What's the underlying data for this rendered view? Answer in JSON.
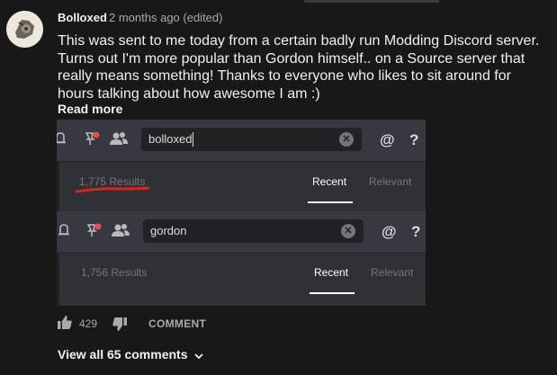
{
  "comment": {
    "author": "Bolloxed",
    "time": "2 months ago (edited)",
    "text": "This was sent to me today from a certain badly run Modding Discord server. Turns out I'm more popular than Gordon himself.. on a Source server that really means something!  Thanks to everyone who likes to sit around for hours talking about how awesome I am :)",
    "read_more": "Read more",
    "likes": "429",
    "comment_label": "COMMENT",
    "view_all": "View all 65 comments"
  },
  "screenshots": [
    {
      "query": "bolloxed",
      "results": "1,775 Results",
      "tab_recent": "Recent",
      "tab_relevant": "Relevant",
      "at_icon": "@",
      "help_icon": "?"
    },
    {
      "query": "gordon",
      "results": "1,756 Results",
      "tab_recent": "Recent",
      "tab_relevant": "Relevant",
      "at_icon": "@",
      "help_icon": "?"
    }
  ],
  "colors": {
    "page_bg": "#181818",
    "discord_bg": "#2f3136",
    "discord_header": "#36393f",
    "red_underline": "#e0201b",
    "notification_dot": "#f04747"
  },
  "icons": [
    "avatar",
    "bell-icon",
    "pin-icon",
    "members-icon",
    "clear-icon",
    "mention-icon",
    "help-icon",
    "thumbs-up-icon",
    "thumbs-down-icon",
    "chevron-down-icon"
  ]
}
